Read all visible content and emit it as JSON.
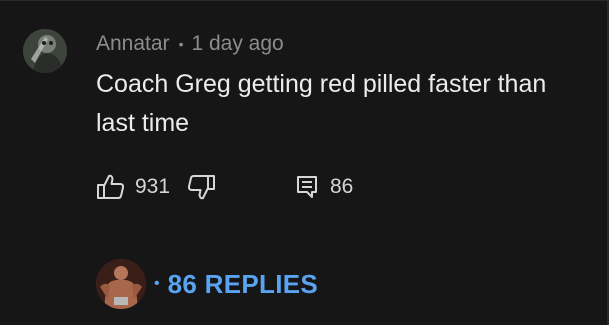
{
  "comment": {
    "author": "Annatar",
    "separator": "•",
    "timestamp": "1 day ago",
    "text": "Coach Greg getting red pilled faster than last time",
    "likes": "931",
    "reply_count": "86",
    "replies_separator": "•",
    "replies_label": "86 REPLIES"
  },
  "colors": {
    "background": "#161616",
    "meta_text": "#8c8c8c",
    "body_text": "#ececec",
    "replies_accent": "#5aa3f0"
  },
  "icons": {
    "like": "thumbs-up-icon",
    "dislike": "thumbs-down-icon",
    "reply": "comment-icon"
  }
}
